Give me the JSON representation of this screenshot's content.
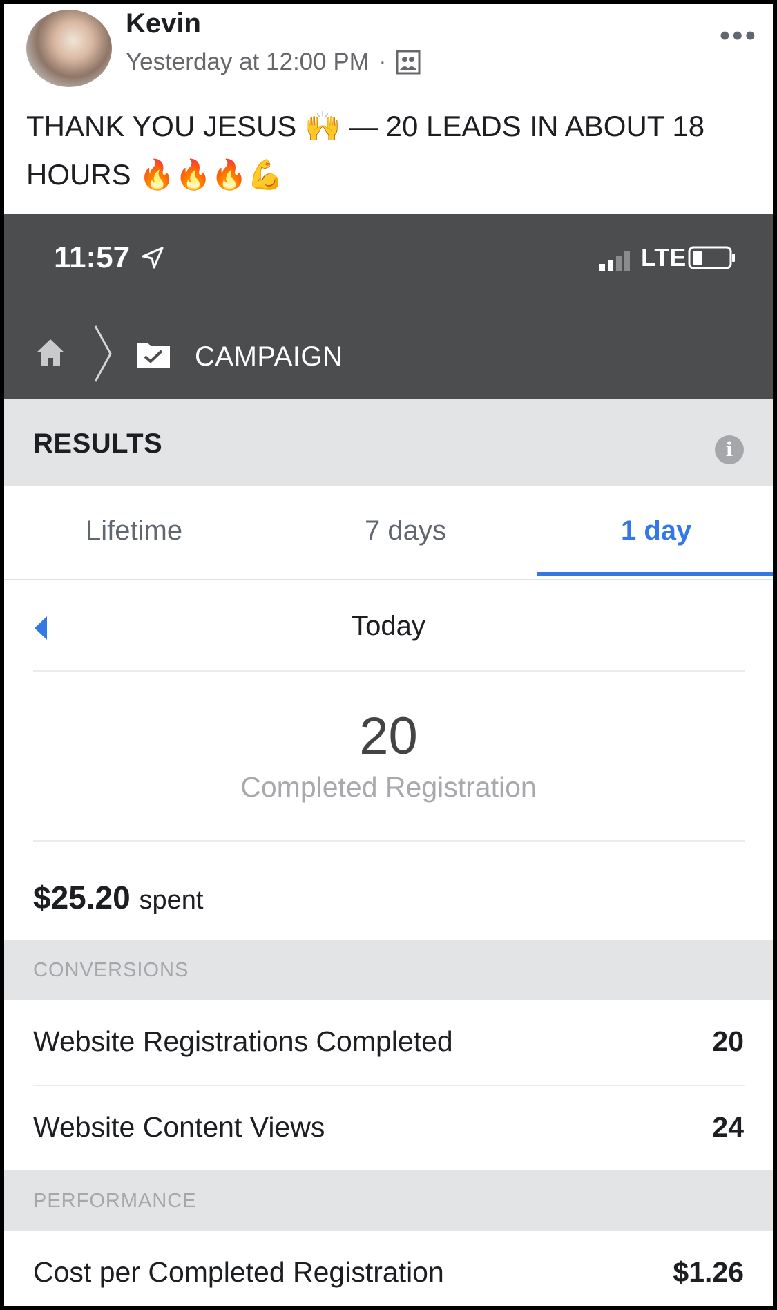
{
  "post": {
    "author": "Kevin",
    "timestamp": "Yesterday at 12:00 PM",
    "separator": "·",
    "audience_icon": "friends-icon",
    "more_icon": "•••",
    "text": "THANK YOU JESUS 🙌 — 20 LEADS IN ABOUT 18 HOURS 🔥🔥🔥💪"
  },
  "status_bar": {
    "time": "11:57",
    "network": "LTE"
  },
  "nav": {
    "title": "CAMPAIGN"
  },
  "results": {
    "title": "RESULTS",
    "info_glyph": "i"
  },
  "tabs": {
    "items": [
      "Lifetime",
      "7 days",
      "1 day"
    ],
    "active": "1 day"
  },
  "date": {
    "label": "Today"
  },
  "summary": {
    "value": "20",
    "label": "Completed Registration",
    "spent_amount": "$25.20",
    "spent_unit": "spent"
  },
  "conversions": {
    "header": "CONVERSIONS",
    "rows": [
      {
        "label": "Website Registrations Completed",
        "value": "20"
      },
      {
        "label": "Website Content Views",
        "value": "24"
      }
    ]
  },
  "performance": {
    "header": "PERFORMANCE",
    "rows": [
      {
        "label": "Cost per Completed Registration",
        "value": "$1.26"
      }
    ]
  },
  "colors": {
    "accent": "#3578e5",
    "nav_bg": "#4c4d4f",
    "section_bg": "#e3e4e6"
  }
}
